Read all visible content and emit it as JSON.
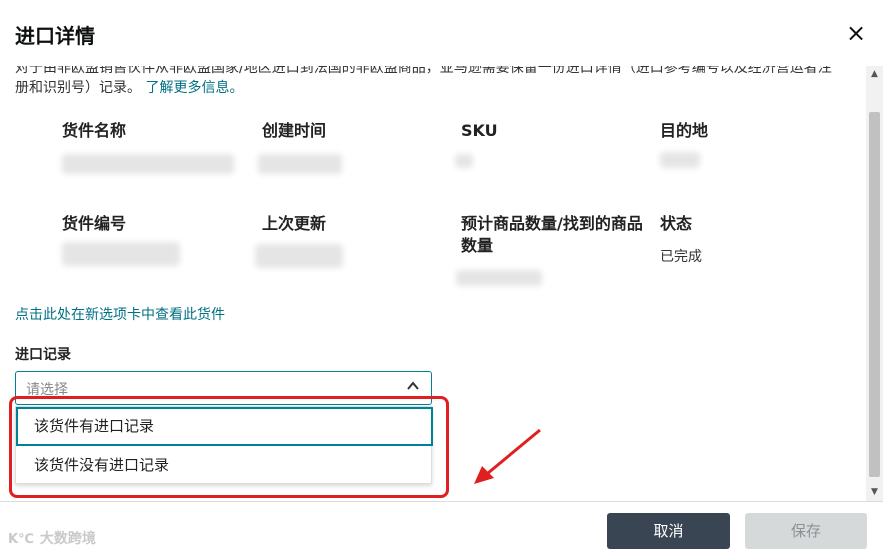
{
  "modal": {
    "title": "进口详情",
    "close_icon": "×"
  },
  "intro": {
    "text": "对于由非欧盟销售伙伴从非欧盟国家/地区进口到法国的非欧盟商品，亚马逊需要保留一份进口详情（进口参考编号以及经济营运者注册和识别号）记录。",
    "link": "了解更多信息。"
  },
  "fields": {
    "shipment_name": "货件名称",
    "created_time": "创建时间",
    "sku": "SKU",
    "destination": "目的地",
    "shipment_id": "货件编号",
    "last_updated": "上次更新",
    "quantity": "预计商品数量/找到的商品数量",
    "status": "状态",
    "status_value": "已完成"
  },
  "view_link": "点击此处在新选项卡中查看此货件",
  "import_record": {
    "label": "进口记录",
    "placeholder": "请选择",
    "options": [
      "该货件有进口记录",
      "该货件没有进口记录"
    ]
  },
  "footer": {
    "cancel": "取消",
    "save": "保存"
  },
  "watermark": {
    "logo": "K℃",
    "text": "大数跨境"
  },
  "colors": {
    "accent": "#008296",
    "link": "#007185",
    "cancel_bg": "#3a4553",
    "highlight": "#e02020"
  }
}
